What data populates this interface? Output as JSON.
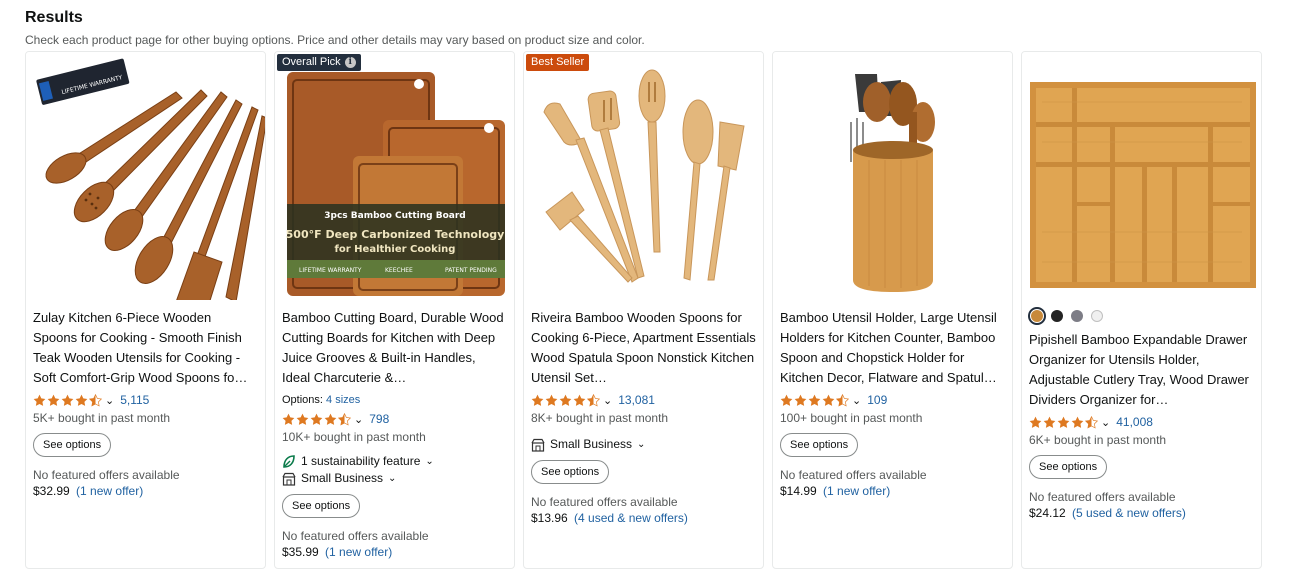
{
  "header": {
    "title": "Results",
    "subtitle": "Check each product page for other buying options. Price and other details may vary based on product size and color."
  },
  "products": [
    {
      "badge": "",
      "title": "Zulay Kitchen 6-Piece Wooden Spoons for Cooking - Smooth Finish Teak Wooden Utensils for Cooking - Soft Comfort-Grip Wood Spoons fo…",
      "rating": 4.5,
      "reviews": "5,115",
      "bought": "5K+ bought in past month",
      "button": "See options",
      "no_offers": "No featured offers available",
      "price": "$32.99",
      "offer_link": "(1 new offer)",
      "image_label": "LIFETIME WARRANTY"
    },
    {
      "badge": "Overall Pick",
      "title": "Bamboo Cutting Board, Durable Wood Cutting Boards for Kitchen with Deep Juice Grooves & Built-in Handles, Ideal Charcuterie &…",
      "options_prefix": "Options:",
      "options_link": "4 sizes",
      "rating": 4.5,
      "reviews": "798",
      "bought": "10K+ bought in past month",
      "sustainability": "1 sustainability feature",
      "small_business": "Small Business",
      "button": "See options",
      "no_offers": "No featured offers available",
      "price": "$35.99",
      "offer_link": "(1 new offer)",
      "image_text": {
        "line1": "3pcs Bamboo Cutting Board",
        "line2": "500°F Deep Carbonized Technology",
        "line3": "for Healthier Cooking",
        "footer1": "LIFETIME WARRANTY",
        "footer2": "KEECHEE",
        "footer3": "PATENT PENDING"
      }
    },
    {
      "badge": "Best Seller",
      "title": "Riveira Bamboo Wooden Spoons for Cooking 6-Piece, Apartment Essentials Wood Spatula Spoon Nonstick Kitchen Utensil Set…",
      "rating": 4.5,
      "reviews": "13,081",
      "bought": "8K+ bought in past month",
      "small_business": "Small Business",
      "button": "See options",
      "no_offers": "No featured offers available",
      "price": "$13.96",
      "offer_link": "(4 used & new offers)"
    },
    {
      "badge": "",
      "title": "Bamboo Utensil Holder, Large Utensil Holders for Kitchen Counter, Bamboo Spoon and Chopstick Holder for Kitchen Decor, Flatware and Spatul…",
      "rating": 4.5,
      "reviews": "109",
      "bought": "100+ bought in past month",
      "button": "See options",
      "no_offers": "No featured offers available",
      "price": "$14.99",
      "offer_link": "(1 new offer)"
    },
    {
      "badge": "",
      "swatches": [
        "#c8893a",
        "#232323",
        "#7d7d86",
        "#f0f0f0"
      ],
      "title": "Pipishell Bamboo Expandable Drawer Organizer for Utensils Holder, Adjustable Cutlery Tray, Wood Drawer Dividers Organizer for…",
      "rating": 4.5,
      "reviews": "41,008",
      "bought": "6K+ bought in past month",
      "button": "See options",
      "no_offers": "No featured offers available",
      "price": "$24.12",
      "offer_link": "(5 used & new offers)"
    }
  ],
  "colors": {
    "star": "#de7921",
    "link": "#2162a1",
    "overall_pick_badge": "#232f3e",
    "best_seller_badge": "#cc4b0c"
  }
}
